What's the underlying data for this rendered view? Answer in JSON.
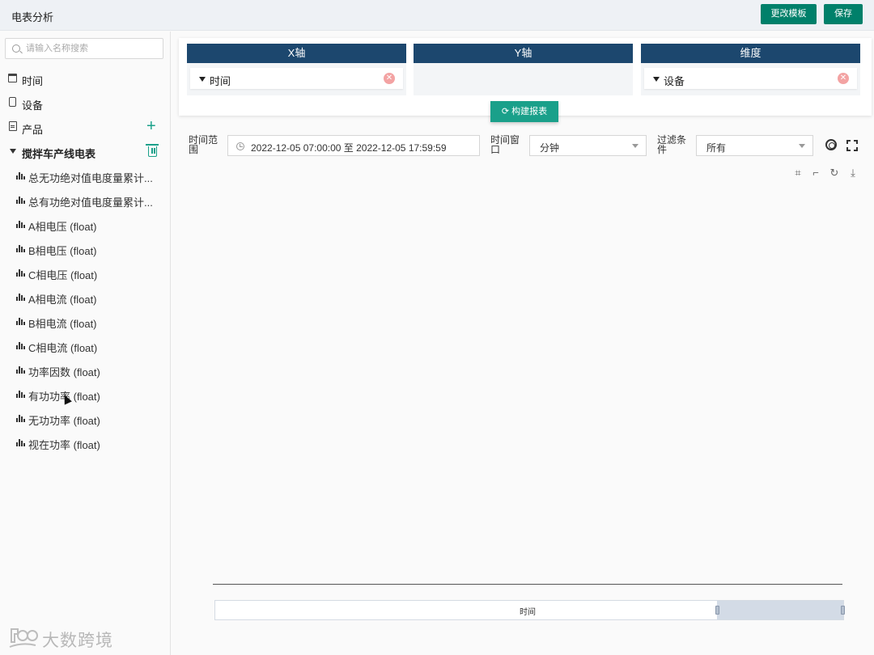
{
  "app": {
    "title": "电表分析",
    "btn_template": "更改模板",
    "btn_save": "保存"
  },
  "sidebar": {
    "search_placeholder": "请输入名称搜索",
    "nav": [
      {
        "label": "时间",
        "icon": "calendar-icon"
      },
      {
        "label": "设备",
        "icon": "device-icon"
      },
      {
        "label": "产品",
        "icon": "document-icon"
      }
    ],
    "group": {
      "label": "搅拌车产线电表",
      "icon": "trash-icon"
    },
    "metrics": [
      "总无功绝对值电度量累计...",
      "总有功绝对值电度量累计...",
      "A相电压 (float)",
      "B相电压 (float)",
      "C相电压 (float)",
      "A相电流 (float)",
      "B相电流 (float)",
      "C相电流 (float)",
      "功率因数 (float)",
      "有功功率 (float)",
      "无功功率 (float)",
      "视在功率 (float)"
    ],
    "logo_text": "大数跨境"
  },
  "axes": {
    "x": {
      "header": "X轴",
      "chip": "时间"
    },
    "y": {
      "header": "Y轴"
    },
    "dim": {
      "header": "维度",
      "chip": "设备"
    },
    "build_label": "构建报表"
  },
  "filters": {
    "range_label": "时间范围",
    "range_value": "2022-12-05 07:00:00 至 2022-12-05 17:59:59",
    "window_label": "时间窗口",
    "window_value": "分钟",
    "filter_label": "过滤条件",
    "filter_value": "所有"
  },
  "chart": {
    "zoom_label": "时间"
  }
}
